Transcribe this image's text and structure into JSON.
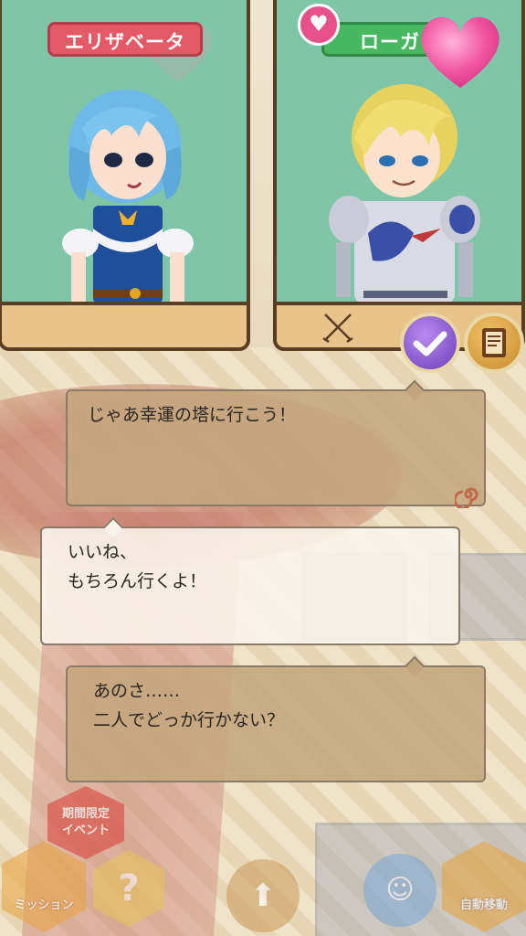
{
  "characters": {
    "left": {
      "name": "エリザベータ"
    },
    "right": {
      "name": "ローガ"
    }
  },
  "dialogue": [
    {
      "lines": [
        "じゃあ幸運の塔に行こう！"
      ]
    },
    {
      "lines": [
        "いいね、",
        "もちろん行くよ！"
      ]
    },
    {
      "lines": [
        "あのさ……",
        "二人でどっか行かない？"
      ]
    }
  ],
  "bottom_menu": {
    "event_badge": [
      "期間限定",
      "イベント"
    ],
    "mission_label": "ミッション",
    "auto_move_label": "自動移動"
  },
  "colors": {
    "name_left": "#e35a66",
    "name_right": "#49b760",
    "scene_bg": "#7fc6a8",
    "heart": "#e8508a"
  }
}
